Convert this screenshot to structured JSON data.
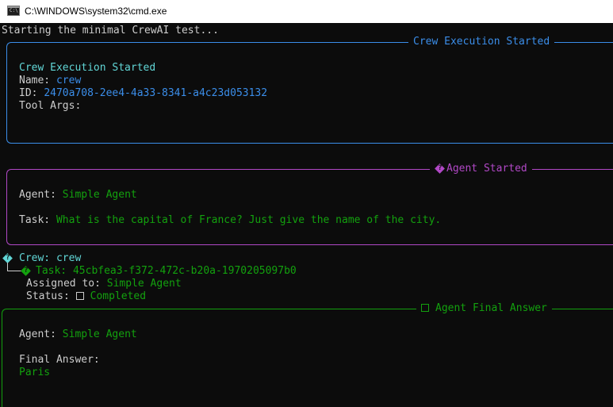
{
  "window": {
    "title": "C:\\WINDOWS\\system32\\cmd.exe",
    "icon_label": "C:\\"
  },
  "console": {
    "first_line": "Starting the minimal CrewAI test...",
    "crew_panel": {
      "title": "Crew Execution Started",
      "heading": "Crew Execution Started",
      "name_label": "Name: ",
      "name_value": "crew",
      "id_label": "ID: ",
      "id_value": "2470a708-2ee4-4a33-8341-a4c23d053132",
      "tool_args_label": "Tool Args:"
    },
    "agent_panel": {
      "title": "Agent Started",
      "agent_label": "Agent: ",
      "agent_value": "Simple Agent",
      "task_label": "Task: ",
      "task_value": "What is the capital of France? Just give the name of the city."
    },
    "tree": {
      "crew_label": "Crew: ",
      "crew_value": "crew",
      "task_label": "Task: ",
      "task_value": "45cbfea3-f372-472c-b20a-1970205097b0",
      "assigned_label": "Assigned to: ",
      "assigned_value": "Simple Agent",
      "status_label": "Status: ",
      "status_value": "Completed"
    },
    "final_panel": {
      "title": "Agent Final Answer",
      "agent_label": "Agent: ",
      "agent_value": "Simple Agent",
      "answer_label": "Final Answer:",
      "answer_value": "Paris"
    }
  },
  "colors": {
    "background": "#0c0c0c",
    "text": "#cccccc",
    "cyan": "#61d6d6",
    "blue": "#3b8eea",
    "purple": "#b148c6",
    "green": "#13a10e"
  },
  "icons": {
    "window": "cmd-icon",
    "agent_started": "diamond-question-icon",
    "crew_tree": "diamond-question-icon",
    "task": "diamond-question-icon",
    "status": "checkbox-icon",
    "final_answer": "checkbox-icon"
  }
}
